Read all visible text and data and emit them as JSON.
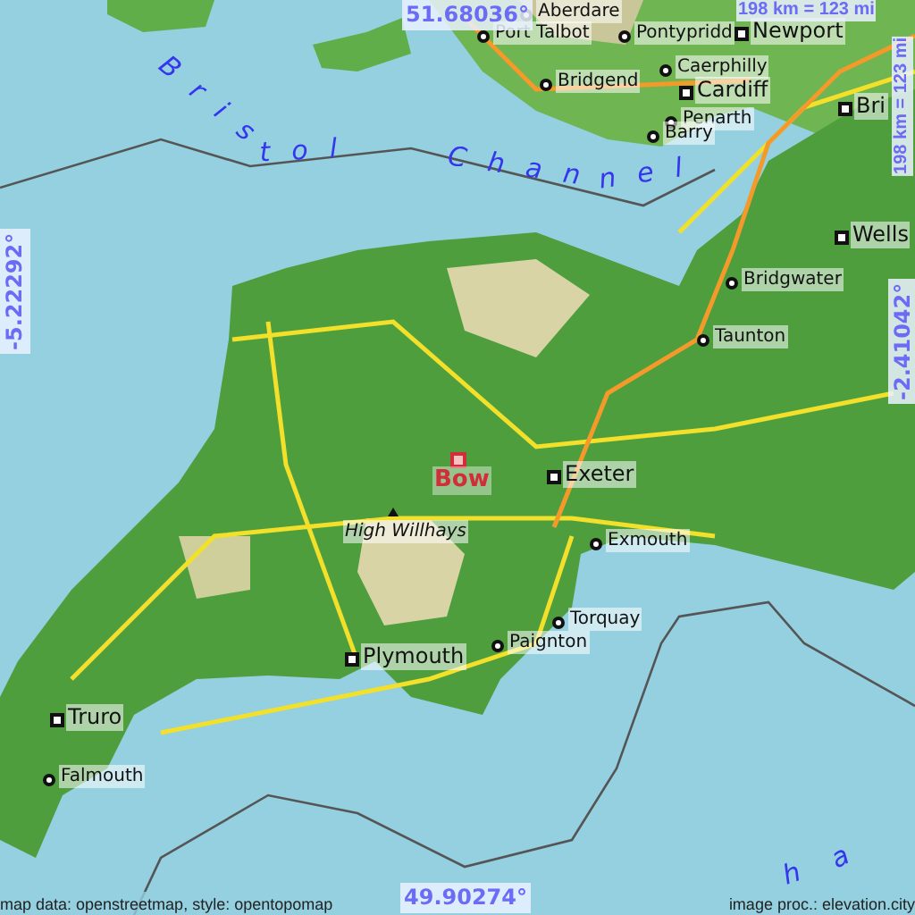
{
  "coordinates": {
    "north": "51.68036°",
    "south": "49.90274°",
    "west": "-5.22292°",
    "east": "-2.41042°"
  },
  "scale": {
    "horizontal": "198 km = 123 mi",
    "vertical": "198 km = 123 mi"
  },
  "water_labels": [
    {
      "text": "Bristol"
    },
    {
      "text": "Channel"
    },
    {
      "text": "ha"
    }
  ],
  "places": [
    {
      "name": "Aberdare",
      "kind": "town"
    },
    {
      "name": "Port Talbot",
      "kind": "town"
    },
    {
      "name": "Pontypridd",
      "kind": "town"
    },
    {
      "name": "Newport",
      "kind": "city"
    },
    {
      "name": "Caerphilly",
      "kind": "town"
    },
    {
      "name": "Bridgend",
      "kind": "town"
    },
    {
      "name": "Cardiff",
      "kind": "city"
    },
    {
      "name": "Penarth",
      "kind": "town"
    },
    {
      "name": "Barry",
      "kind": "town"
    },
    {
      "name": "Bri",
      "kind": "city"
    },
    {
      "name": "Wells",
      "kind": "city"
    },
    {
      "name": "Bridgwater",
      "kind": "town"
    },
    {
      "name": "Taunton",
      "kind": "town"
    },
    {
      "name": "Exeter",
      "kind": "city"
    },
    {
      "name": "Bow",
      "kind": "selected"
    },
    {
      "name": "High Willhays",
      "kind": "peak"
    },
    {
      "name": "Exmouth",
      "kind": "town"
    },
    {
      "name": "Torquay",
      "kind": "town"
    },
    {
      "name": "Paignton",
      "kind": "town"
    },
    {
      "name": "Plymouth",
      "kind": "city"
    },
    {
      "name": "Truro",
      "kind": "city"
    },
    {
      "name": "Falmouth",
      "kind": "town"
    }
  ],
  "attribution": {
    "map_data": "map data: openstreetmap, style: opentopomap",
    "image_proc": "image proc.: elevation.city"
  }
}
